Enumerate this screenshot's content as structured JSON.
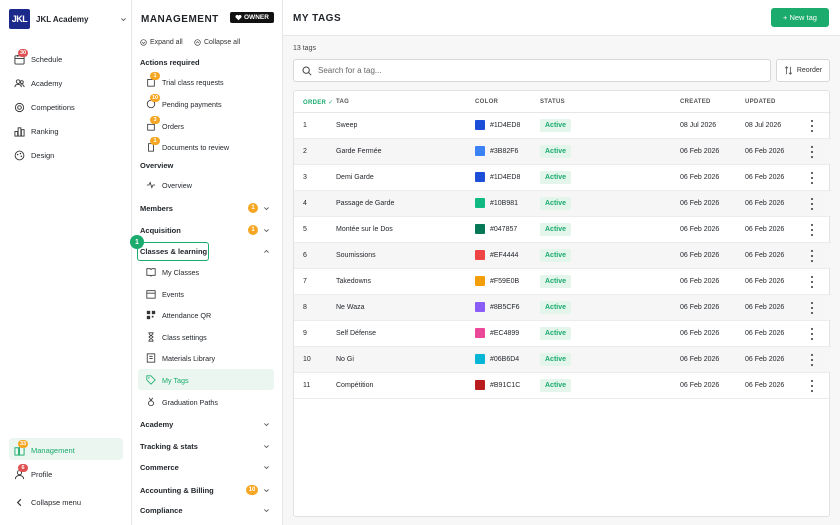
{
  "sidebar": {
    "brand_logo": "JKL",
    "brand_name": "JKL Academy",
    "items": [
      {
        "label": "Schedule",
        "icon": "calendar-icon",
        "badge": "30"
      },
      {
        "label": "Academy",
        "icon": "users-icon",
        "badge": ""
      },
      {
        "label": "Competitions",
        "icon": "target-icon",
        "badge": ""
      },
      {
        "label": "Ranking",
        "icon": "ranking-icon",
        "badge": ""
      },
      {
        "label": "Design",
        "icon": "palette-icon",
        "badge": ""
      }
    ],
    "management": {
      "label": "Management",
      "badge": "33"
    },
    "profile": {
      "label": "Profile",
      "badge": "6"
    },
    "collapse": "Collapse menu"
  },
  "panel": {
    "title": "MANAGEMENT",
    "role": "OWNER",
    "expand_all": "Expand all",
    "collapse_all": "Collapse all",
    "actions_required": "Actions required",
    "actions": [
      {
        "label": "Trial class requests",
        "badge": "1"
      },
      {
        "label": "Pending payments",
        "badge": "10"
      },
      {
        "label": "Orders",
        "badge": "3"
      },
      {
        "label": "Documents to review",
        "badge": "1"
      }
    ],
    "overview_heading": "Overview",
    "overview_item": "Overview",
    "members": {
      "label": "Members",
      "badge": "1"
    },
    "acquisition": {
      "label": "Acquisition",
      "badge": "1"
    },
    "classes": {
      "label": "Classes & learning",
      "step": "1"
    },
    "class_items": [
      "My Classes",
      "Events",
      "Attendance QR",
      "Class settings",
      "Materials Library",
      "My Tags",
      "Graduation Paths"
    ],
    "bottom_sections": [
      {
        "label": "Academy",
        "badge": ""
      },
      {
        "label": "Tracking & stats",
        "badge": ""
      },
      {
        "label": "Commerce",
        "badge": ""
      },
      {
        "label": "Accounting & Billing",
        "badge": "10"
      },
      {
        "label": "Compliance",
        "badge": ""
      }
    ]
  },
  "main": {
    "title": "MY TAGS",
    "new_tag": "+ New tag",
    "count": "13 tags",
    "search_placeholder": "Search for a tag...",
    "reorder": "Reorder",
    "columns": {
      "order": "ORDER ✓",
      "tag": "TAG",
      "color": "COLOR",
      "status": "STATUS",
      "created": "CREATED",
      "updated": "UPDATED"
    },
    "rows": [
      {
        "order": "1",
        "tag": "Sweep",
        "color": "#1D4ED8",
        "status": "Active",
        "created": "08 Jul 2026",
        "updated": "08 Jul 2026"
      },
      {
        "order": "2",
        "tag": "Garde Fermée",
        "color": "#3B82F6",
        "status": "Active",
        "created": "06 Feb 2026",
        "updated": "06 Feb 2026"
      },
      {
        "order": "3",
        "tag": "Demi Garde",
        "color": "#1D4ED8",
        "status": "Active",
        "created": "06 Feb 2026",
        "updated": "06 Feb 2026"
      },
      {
        "order": "4",
        "tag": "Passage de Garde",
        "color": "#10B981",
        "status": "Active",
        "created": "06 Feb 2026",
        "updated": "06 Feb 2026"
      },
      {
        "order": "5",
        "tag": "Montée sur le Dos",
        "color": "#047857",
        "status": "Active",
        "created": "06 Feb 2026",
        "updated": "06 Feb 2026"
      },
      {
        "order": "6",
        "tag": "Soumissions",
        "color": "#EF4444",
        "status": "Active",
        "created": "06 Feb 2026",
        "updated": "06 Feb 2026"
      },
      {
        "order": "7",
        "tag": "Takedowns",
        "color": "#F59E0B",
        "status": "Active",
        "created": "06 Feb 2026",
        "updated": "06 Feb 2026"
      },
      {
        "order": "8",
        "tag": "Ne Waza",
        "color": "#8B5CF6",
        "status": "Active",
        "created": "06 Feb 2026",
        "updated": "06 Feb 2026"
      },
      {
        "order": "9",
        "tag": "Self Défense",
        "color": "#EC4899",
        "status": "Active",
        "created": "06 Feb 2026",
        "updated": "06 Feb 2026"
      },
      {
        "order": "10",
        "tag": "No Gi",
        "color": "#06B6D4",
        "status": "Active",
        "created": "06 Feb 2026",
        "updated": "06 Feb 2026"
      },
      {
        "order": "11",
        "tag": "Compétition",
        "color": "#B91C1C",
        "status": "Active",
        "created": "06 Feb 2026",
        "updated": "06 Feb 2026"
      }
    ]
  },
  "colors": {
    "accent": "#1aab6d",
    "brand": "#1b2a8a"
  }
}
